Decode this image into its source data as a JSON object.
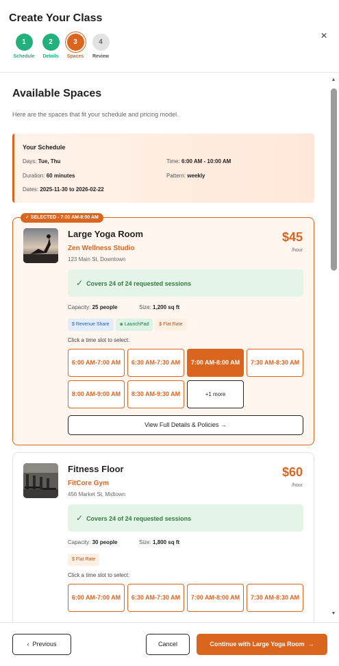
{
  "header": {
    "title": "Create Your Class",
    "close_icon": "×",
    "steps": [
      {
        "number": "1",
        "label": "Schedule",
        "state": "done"
      },
      {
        "number": "2",
        "label": "Details",
        "state": "done"
      },
      {
        "number": "3",
        "label": "Spaces",
        "state": "active"
      },
      {
        "number": "4",
        "label": "Review",
        "state": "todo"
      }
    ]
  },
  "main": {
    "title": "Available Spaces",
    "subtitle": "Here are the spaces that fit your schedule and pricing model.",
    "schedule": {
      "title": "Your Schedule",
      "days_label": "Days:",
      "days": "Tue, Thu",
      "time_label": "Time:",
      "time": "6:00 AM - 10:00 AM",
      "duration_label": "Duration:",
      "duration": "60 minutes",
      "pattern_label": "Pattern:",
      "pattern": "weekly",
      "dates_label": "Dates:",
      "dates": "2025-11-30 to 2026-02-22"
    },
    "spaces": [
      {
        "badge": "✓ SELECTED - 7:00 AM-8:00 AM",
        "name": "Large Yoga Room",
        "studio": "Zen Wellness Studio",
        "address": "123 Main St, Downtown",
        "price": "$45",
        "per": "/hour",
        "covers": "Covers 24 of 24 requested sessions",
        "capacity_label": "Capacity:",
        "capacity": "25 people",
        "size_label": "Size:",
        "size": "1,200 sq ft",
        "tags": [
          {
            "icon": "$",
            "label": "Revenue Share"
          },
          {
            "icon": "◈",
            "label": "LaunchPad"
          },
          {
            "icon": "$",
            "label": "Flat Rate"
          }
        ],
        "slot_prompt": "Click a time slot to select:",
        "slots": [
          "6:00 AM-7:00 AM",
          "6:30 AM-7:30 AM",
          "7:00 AM-8:00 AM",
          "7:30 AM-8:30 AM",
          "8:00 AM-9:00 AM",
          "8:30 AM-9:30 AM"
        ],
        "more": "+1 more",
        "details_button": "View Full Details & Policies →"
      },
      {
        "name": "Fitness Floor",
        "studio": "FitCore Gym",
        "address": "456 Market St, Midtown",
        "price": "$60",
        "per": "/hour",
        "covers": "Covers 24 of 24 requested sessions",
        "capacity_label": "Capacity:",
        "capacity": "30 people",
        "size_label": "Size:",
        "size": "1,800 sq ft",
        "tags": [
          {
            "icon": "$",
            "label": "Flat Rate"
          }
        ],
        "slot_prompt": "Click a time slot to select:",
        "slots": [
          "6:00 AM-7:00 AM",
          "6:30 AM-7:30 AM",
          "7:00 AM-8:00 AM",
          "7:30 AM-8:30 AM"
        ]
      }
    ]
  },
  "footer": {
    "previous": "Previous",
    "previous_icon": "‹",
    "cancel": "Cancel",
    "continue": "Continue with Large Yoga Room",
    "continue_icon": "→"
  },
  "colors": {
    "accent": "#d9651f",
    "success": "#22b07d"
  }
}
